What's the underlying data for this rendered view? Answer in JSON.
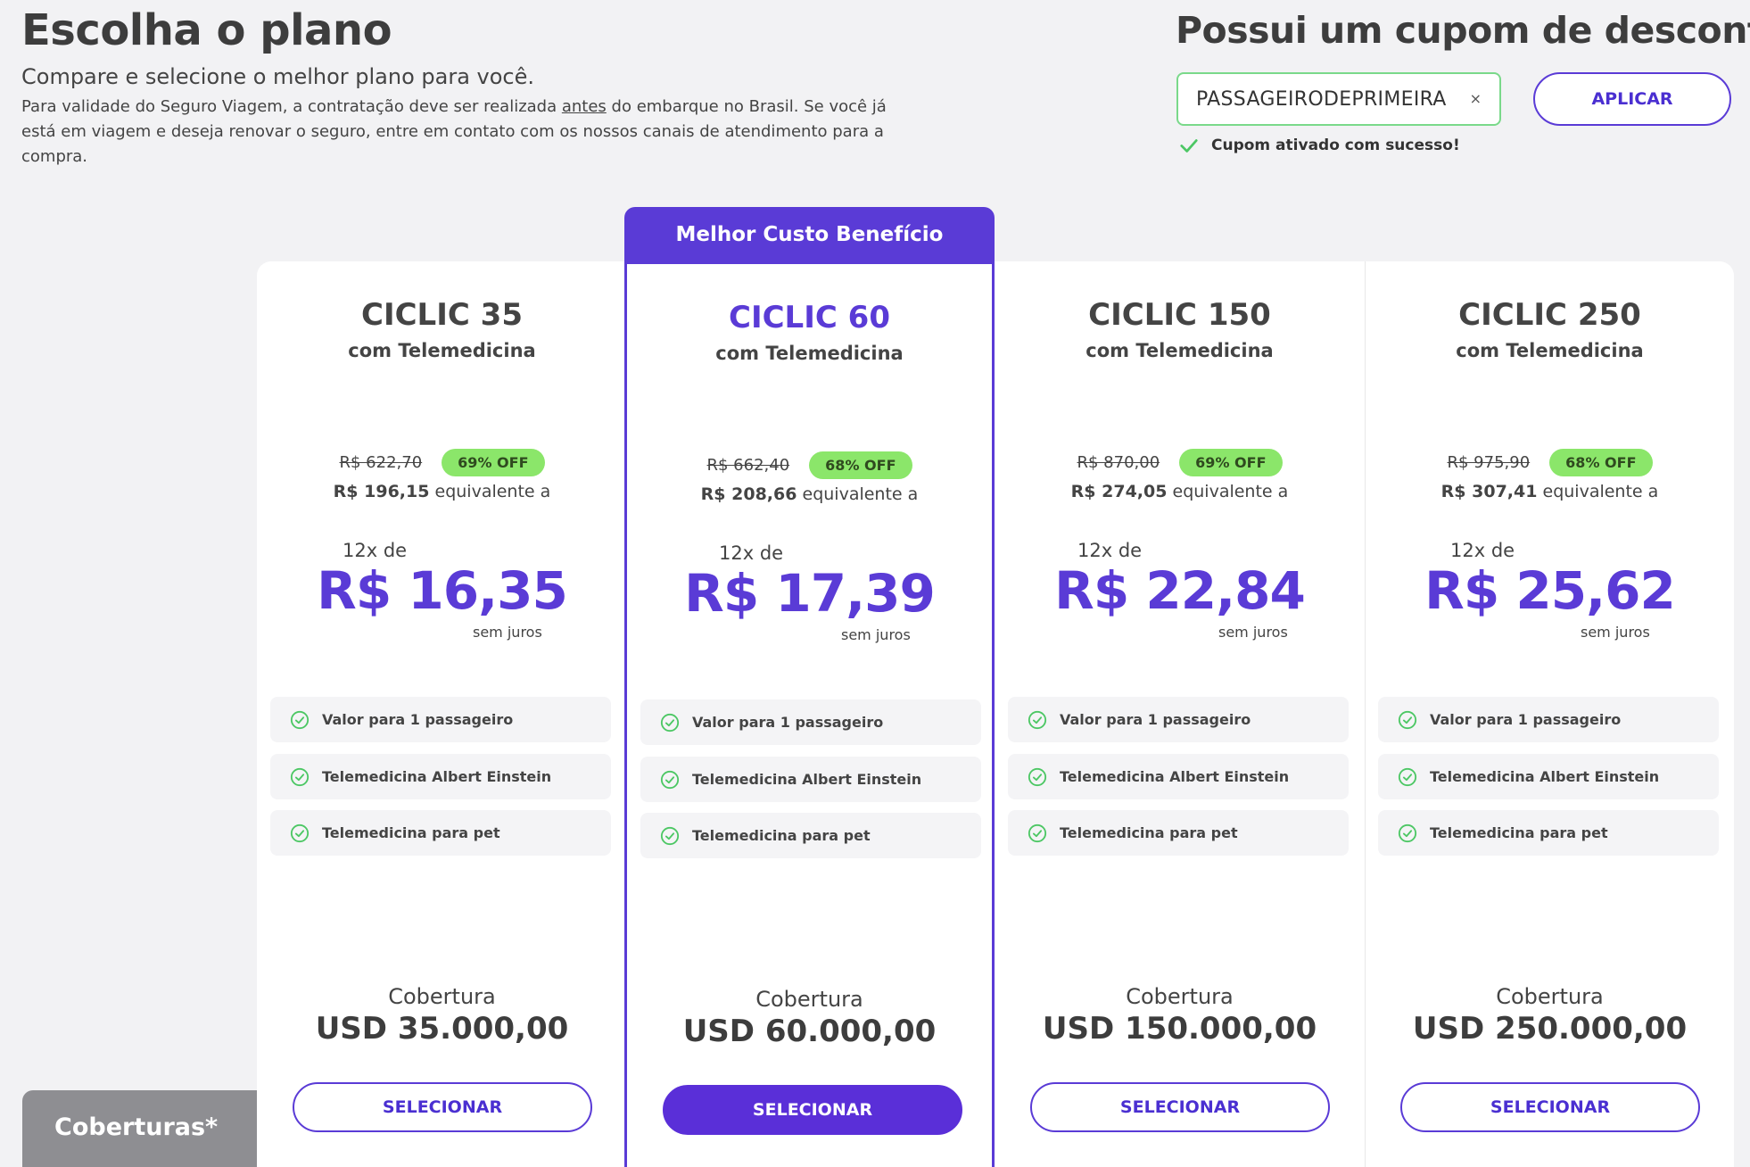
{
  "header": {
    "title": "Escolha o plano",
    "subtitle": "Compare e selecione o melhor plano para você.",
    "note_before": "Para validade do Seguro Viagem, a contratação deve ser realizada ",
    "note_underline": "antes",
    "note_after": " do embarque no Brasil. Se você já está em viagem e deseja renovar o seguro, entre em contato com os nossos canais de atendimento para a compra."
  },
  "coupon": {
    "title": "Possui um cupom de desconto?",
    "value": "PASSAGEIRODEPRIMEIRA",
    "clear": "×",
    "apply_label": "APLICAR",
    "success": "Cupom ativado com sucesso!"
  },
  "best_tag": "Melhor Custo Benefício",
  "colors": {
    "accent": "#5a3bd6",
    "badge": "#8be66a",
    "check": "#4cc764"
  },
  "plans": [
    {
      "name": "CICLIC 35",
      "sub": "com Telemedicina",
      "old_price": "R$ 622,70",
      "off": "69% OFF",
      "equiv_price": "R$ 196,15",
      "equiv_text": " equivalente a",
      "installments": "12x de",
      "price": "R$ 16,35",
      "juros": "sem juros",
      "features": [
        "Valor para 1 passageiro",
        "Telemedicina Albert Einstein",
        "Telemedicina para pet"
      ],
      "cob_label": "Cobertura",
      "cob_value": "USD 35.000,00",
      "select": "SELECIONAR"
    },
    {
      "name": "CICLIC 60",
      "sub": "com Telemedicina",
      "old_price": "R$ 662,40",
      "off": "68% OFF",
      "equiv_price": "R$ 208,66",
      "equiv_text": " equivalente a",
      "installments": "12x de",
      "price": "R$ 17,39",
      "juros": "sem juros",
      "features": [
        "Valor para 1 passageiro",
        "Telemedicina Albert Einstein",
        "Telemedicina para pet"
      ],
      "cob_label": "Cobertura",
      "cob_value": "USD 60.000,00",
      "select": "SELECIONAR"
    },
    {
      "name": "CICLIC 150",
      "sub": "com Telemedicina",
      "old_price": "R$ 870,00",
      "off": "69% OFF",
      "equiv_price": "R$ 274,05",
      "equiv_text": " equivalente a",
      "installments": "12x de",
      "price": "R$ 22,84",
      "juros": "sem juros",
      "features": [
        "Valor para 1 passageiro",
        "Telemedicina Albert Einstein",
        "Telemedicina para pet"
      ],
      "cob_label": "Cobertura",
      "cob_value": "USD 150.000,00",
      "select": "SELECIONAR"
    },
    {
      "name": "CICLIC 250",
      "sub": "com Telemedicina",
      "old_price": "R$ 975,90",
      "off": "68% OFF",
      "equiv_price": "R$ 307,41",
      "equiv_text": " equivalente a",
      "installments": "12x de",
      "price": "R$ 25,62",
      "juros": "sem juros",
      "features": [
        "Valor para 1 passageiro",
        "Telemedicina Albert Einstein",
        "Telemedicina para pet"
      ],
      "cob_label": "Cobertura",
      "cob_value": "USD 250.000,00",
      "select": "SELECIONAR"
    }
  ],
  "coberturas_tab": "Coberturas*"
}
